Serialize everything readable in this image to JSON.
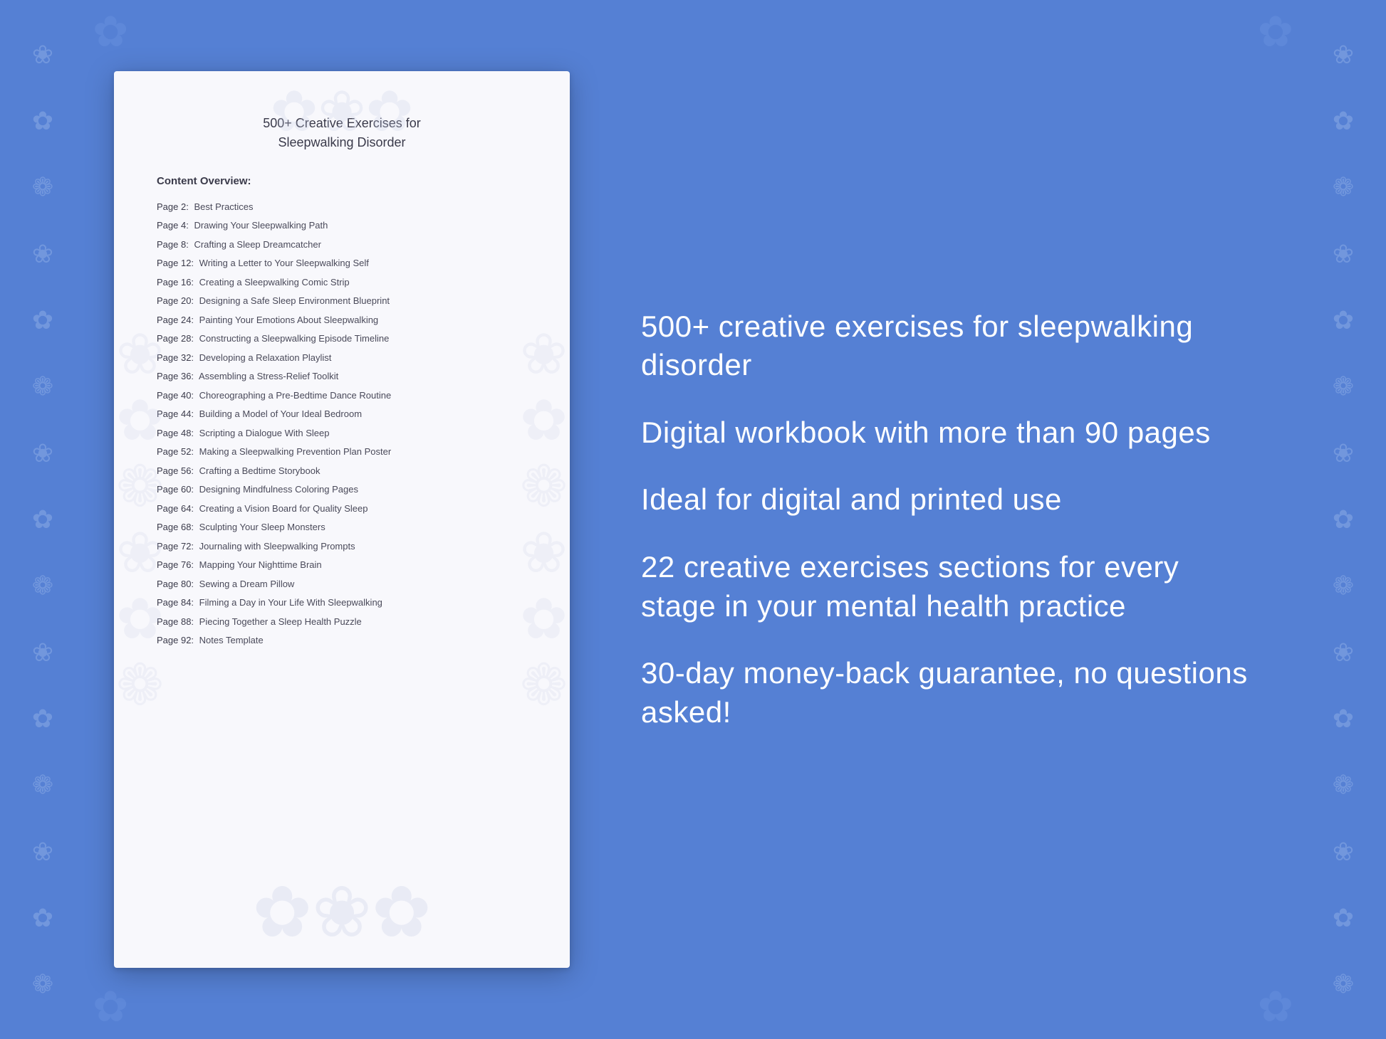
{
  "background_color": "#5580d4",
  "document": {
    "title_line1": "500+ Creative Exercises for",
    "title_line2": "Sleepwalking Disorder",
    "section_heading": "Content Overview:",
    "toc_items": [
      {
        "page": "Page  2:",
        "label": "Best Practices"
      },
      {
        "page": "Page  4:",
        "label": "Drawing Your Sleepwalking Path"
      },
      {
        "page": "Page  8:",
        "label": "Crafting a Sleep Dreamcatcher"
      },
      {
        "page": "Page 12:",
        "label": "Writing a Letter to Your Sleepwalking Self"
      },
      {
        "page": "Page 16:",
        "label": "Creating a Sleepwalking Comic Strip"
      },
      {
        "page": "Page 20:",
        "label": "Designing a Safe Sleep Environment Blueprint"
      },
      {
        "page": "Page 24:",
        "label": "Painting Your Emotions About Sleepwalking"
      },
      {
        "page": "Page 28:",
        "label": "Constructing a Sleepwalking Episode Timeline"
      },
      {
        "page": "Page 32:",
        "label": "Developing a Relaxation Playlist"
      },
      {
        "page": "Page 36:",
        "label": "Assembling a Stress-Relief Toolkit"
      },
      {
        "page": "Page 40:",
        "label": "Choreographing a Pre-Bedtime Dance Routine"
      },
      {
        "page": "Page 44:",
        "label": "Building a Model of Your Ideal Bedroom"
      },
      {
        "page": "Page 48:",
        "label": "Scripting a Dialogue With Sleep"
      },
      {
        "page": "Page 52:",
        "label": "Making a Sleepwalking Prevention Plan Poster"
      },
      {
        "page": "Page 56:",
        "label": "Crafting a Bedtime Storybook"
      },
      {
        "page": "Page 60:",
        "label": "Designing Mindfulness Coloring Pages"
      },
      {
        "page": "Page 64:",
        "label": "Creating a Vision Board for Quality Sleep"
      },
      {
        "page": "Page 68:",
        "label": "Sculpting Your Sleep Monsters"
      },
      {
        "page": "Page 72:",
        "label": "Journaling with Sleepwalking Prompts"
      },
      {
        "page": "Page 76:",
        "label": "Mapping Your Nighttime Brain"
      },
      {
        "page": "Page 80:",
        "label": "Sewing a Dream Pillow"
      },
      {
        "page": "Page 84:",
        "label": "Filming a Day in Your Life With Sleepwalking"
      },
      {
        "page": "Page 88:",
        "label": "Piecing Together a Sleep Health Puzzle"
      },
      {
        "page": "Page 92:",
        "label": "Notes Template"
      }
    ]
  },
  "info_blocks": [
    {
      "text": "500+ creative exercises for sleepwalking disorder"
    },
    {
      "text": "Digital workbook with more than 90 pages"
    },
    {
      "text": "Ideal for digital and printed use"
    },
    {
      "text": "22 creative exercises sections for every stage in your mental health practice"
    },
    {
      "text": "30-day money-back guarantee, no questions asked!"
    }
  ],
  "floral_symbol": "❀",
  "floral_count": 18
}
